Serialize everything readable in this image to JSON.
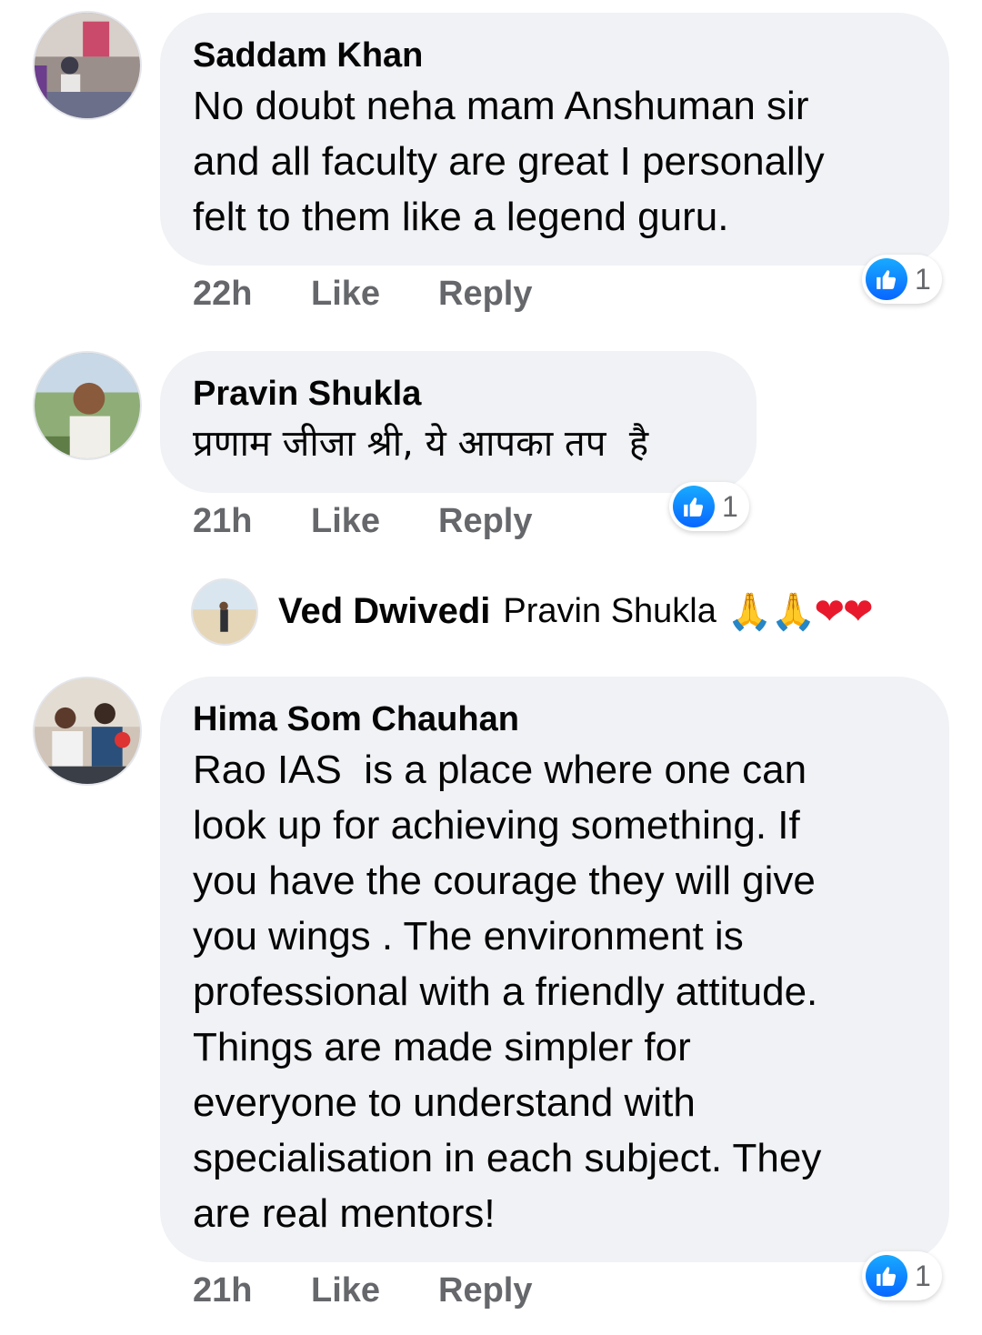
{
  "comments": [
    {
      "author": "Saddam Khan",
      "text": "No doubt neha mam Anshuman sir\nand all faculty are great I personally\nfelt to them like a legend guru.",
      "time": "22h",
      "like_label": "Like",
      "reply_label": "Reply",
      "reaction_count": "1"
    },
    {
      "author": "Pravin Shukla",
      "text": "प्रणाम जीजा श्री, ये आपका तप  है",
      "time": "21h",
      "like_label": "Like",
      "reply_label": "Reply",
      "reaction_count": "1",
      "reply": {
        "author": "Ved Dwivedi",
        "mention": "Pravin Shukla",
        "emojis": [
          "🙏",
          "🙏",
          "❤",
          "❤"
        ]
      }
    },
    {
      "author": "Hima Som Chauhan",
      "text": "Rao IAS  is a place where one can\nlook up for achieving something. If\nyou have the courage they will give\nyou wings . The environment is\nprofessional with a friendly attitude.\nThings are made simpler for\neveryone to understand with\nspecialisation in each subject. They\nare real mentors!",
      "time": "21h",
      "like_label": "Like",
      "reply_label": "Reply",
      "reaction_count": "1"
    }
  ],
  "colors": {
    "bubble": "#f0f2f5",
    "meta_text": "#65676b",
    "like_blue": "#0866ff"
  },
  "icons": {
    "reaction": "thumbs-up-icon"
  }
}
